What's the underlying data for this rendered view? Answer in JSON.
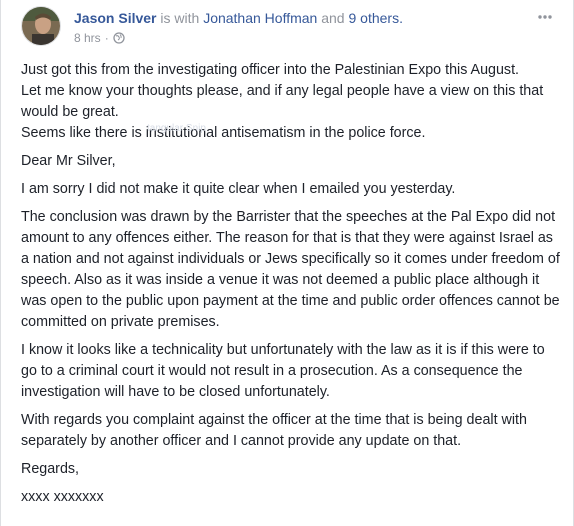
{
  "post": {
    "author": "Jason Silver",
    "with_text": "is with",
    "tagged_name": "Jonathan Hoffman",
    "and_text": "and",
    "others": "9 others.",
    "time": "8 hrs",
    "dot": "·",
    "privacy_icon": "globe-icon",
    "more_icon": "more-options-icon",
    "ghost_text": "tangular Snip",
    "paragraphs": [
      "Just got this from the investigating officer into the Palestinian Expo this August.\nLet me know your thoughts please, and if any legal people have a view on this that would be great.\nSeems like there is institutional antisematism in the police force.",
      "Dear Mr Silver,",
      "I am sorry I did not make it quite clear when I emailed you yesterday.",
      "The conclusion was drawn by the Barrister that the speeches at the Pal Expo did not amount to any offences either. The reason for that is that they were against Israel as a nation and not against individuals or Jews specifically so it comes under freedom of speech. Also as it was inside a venue it was not deemed a public place although it was open to the public upon payment at the time and public order offences cannot be committed on private premises.",
      "I know it looks like a technicality but unfortunately with the law as it is if this were to go to a criminal court it would not result in a prosecution. As a consequence the investigation will have to be closed unfortunately.",
      "With regards you complaint against the officer at the time that is being dealt with separately by another officer and I cannot provide any update on that.",
      "Regards,",
      "xxxx xxxxxxx"
    ]
  },
  "colors": {
    "link": "#365899",
    "meta": "#90949c",
    "text": "#1d2129"
  }
}
